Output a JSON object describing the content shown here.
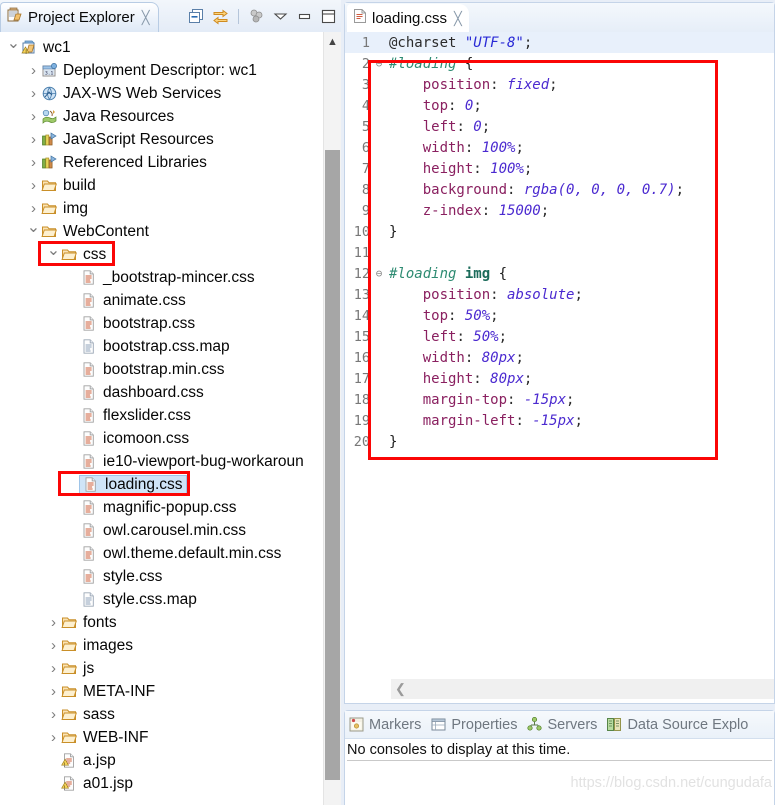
{
  "explorer": {
    "tab_label": "Project Explorer",
    "tab_close": "╳",
    "toolbar": [
      {
        "name": "collapse-all-icon",
        "title": "Collapse All"
      },
      {
        "name": "link-with-editor-icon",
        "title": "Link with Editor"
      },
      {
        "name": "filters-icon",
        "title": "Filters"
      },
      {
        "name": "view-menu-icon",
        "title": "View Menu"
      },
      {
        "name": "minimize-icon",
        "title": "Minimize"
      },
      {
        "name": "maximize-icon",
        "title": "Maximize"
      }
    ],
    "tree": [
      {
        "label": "wc1",
        "depth": 0,
        "arrow": "v",
        "icon": "project-warning-icon"
      },
      {
        "label": "Deployment Descriptor: wc1",
        "depth": 1,
        "arrow": ">",
        "icon": "deployment-descriptor-icon"
      },
      {
        "label": "JAX-WS Web Services",
        "depth": 1,
        "arrow": ">",
        "icon": "jaxws-icon"
      },
      {
        "label": "Java Resources",
        "depth": 1,
        "arrow": ">",
        "icon": "java-resources-icon"
      },
      {
        "label": "JavaScript Resources",
        "depth": 1,
        "arrow": ">",
        "icon": "js-resources-icon"
      },
      {
        "label": "Referenced Libraries",
        "depth": 1,
        "arrow": ">",
        "icon": "library-icon"
      },
      {
        "label": "build",
        "depth": 1,
        "arrow": ">",
        "icon": "folder-icon"
      },
      {
        "label": "img",
        "depth": 1,
        "arrow": ">",
        "icon": "folder-icon"
      },
      {
        "label": "WebContent",
        "depth": 1,
        "arrow": "v",
        "icon": "folder-open-icon"
      },
      {
        "label": "css",
        "depth": 2,
        "arrow": "v",
        "icon": "folder-icon",
        "highlight": "red-box"
      },
      {
        "label": "_bootstrap-mincer.css",
        "depth": 3,
        "arrow": "",
        "icon": "css-file-icon"
      },
      {
        "label": "animate.css",
        "depth": 3,
        "arrow": "",
        "icon": "css-file-icon"
      },
      {
        "label": "bootstrap.css",
        "depth": 3,
        "arrow": "",
        "icon": "css-file-icon"
      },
      {
        "label": "bootstrap.css.map",
        "depth": 3,
        "arrow": "",
        "icon": "plain-file-icon"
      },
      {
        "label": "bootstrap.min.css",
        "depth": 3,
        "arrow": "",
        "icon": "css-file-icon"
      },
      {
        "label": "dashboard.css",
        "depth": 3,
        "arrow": "",
        "icon": "css-file-icon"
      },
      {
        "label": "flexslider.css",
        "depth": 3,
        "arrow": "",
        "icon": "css-file-icon"
      },
      {
        "label": "icomoon.css",
        "depth": 3,
        "arrow": "",
        "icon": "css-file-icon"
      },
      {
        "label": "ie10-viewport-bug-workaroun",
        "depth": 3,
        "arrow": "",
        "icon": "css-file-icon"
      },
      {
        "label": "loading.css",
        "depth": 3,
        "arrow": "",
        "icon": "css-file-icon",
        "selected": true,
        "highlight": "red-box"
      },
      {
        "label": "magnific-popup.css",
        "depth": 3,
        "arrow": "",
        "icon": "css-file-icon"
      },
      {
        "label": "owl.carousel.min.css",
        "depth": 3,
        "arrow": "",
        "icon": "css-file-icon"
      },
      {
        "label": "owl.theme.default.min.css",
        "depth": 3,
        "arrow": "",
        "icon": "css-file-icon"
      },
      {
        "label": "style.css",
        "depth": 3,
        "arrow": "",
        "icon": "css-file-icon"
      },
      {
        "label": "style.css.map",
        "depth": 3,
        "arrow": "",
        "icon": "plain-file-icon"
      },
      {
        "label": "fonts",
        "depth": 2,
        "arrow": ">",
        "icon": "folder-icon"
      },
      {
        "label": "images",
        "depth": 2,
        "arrow": ">",
        "icon": "folder-icon"
      },
      {
        "label": "js",
        "depth": 2,
        "arrow": ">",
        "icon": "folder-icon"
      },
      {
        "label": "META-INF",
        "depth": 2,
        "arrow": ">",
        "icon": "folder-icon"
      },
      {
        "label": "sass",
        "depth": 2,
        "arrow": ">",
        "icon": "folder-icon"
      },
      {
        "label": "WEB-INF",
        "depth": 2,
        "arrow": ">",
        "icon": "folder-icon"
      },
      {
        "label": "a.jsp",
        "depth": 2,
        "arrow": "",
        "icon": "jsp-file-icon"
      },
      {
        "label": "a01.jsp",
        "depth": 2,
        "arrow": "",
        "icon": "jsp-file-icon"
      }
    ]
  },
  "editor": {
    "tab_label": "loading.css",
    "tab_close": "╳",
    "tab_icon": "css-file-icon",
    "code": [
      {
        "n": "1",
        "fold": "",
        "current": true,
        "tokens": [
          {
            "t": "@charset ",
            "c": "tok-at"
          },
          {
            "t": "\"UTF-8\"",
            "c": "tok-str"
          },
          {
            "t": ";",
            "c": "tok-punc"
          }
        ]
      },
      {
        "n": "2",
        "fold": "⊖",
        "tokens": [
          {
            "t": "#loading",
            "c": "tok-sel"
          },
          {
            "t": " {",
            "c": "tok-brace"
          }
        ]
      },
      {
        "n": "3",
        "fold": "",
        "tokens": [
          {
            "t": "    position",
            "c": "tok-prop"
          },
          {
            "t": ": ",
            "c": "tok-punc"
          },
          {
            "t": "fixed",
            "c": "tok-val"
          },
          {
            "t": ";",
            "c": "tok-punc"
          }
        ]
      },
      {
        "n": "4",
        "fold": "",
        "tokens": [
          {
            "t": "    top",
            "c": "tok-prop"
          },
          {
            "t": ": ",
            "c": "tok-punc"
          },
          {
            "t": "0",
            "c": "tok-val"
          },
          {
            "t": ";",
            "c": "tok-punc"
          }
        ]
      },
      {
        "n": "5",
        "fold": "",
        "tokens": [
          {
            "t": "    left",
            "c": "tok-prop"
          },
          {
            "t": ": ",
            "c": "tok-punc"
          },
          {
            "t": "0",
            "c": "tok-val"
          },
          {
            "t": ";",
            "c": "tok-punc"
          }
        ]
      },
      {
        "n": "6",
        "fold": "",
        "tokens": [
          {
            "t": "    width",
            "c": "tok-prop"
          },
          {
            "t": ": ",
            "c": "tok-punc"
          },
          {
            "t": "100%",
            "c": "tok-val"
          },
          {
            "t": ";",
            "c": "tok-punc"
          }
        ]
      },
      {
        "n": "7",
        "fold": "",
        "tokens": [
          {
            "t": "    height",
            "c": "tok-prop"
          },
          {
            "t": ": ",
            "c": "tok-punc"
          },
          {
            "t": "100%",
            "c": "tok-val"
          },
          {
            "t": ";",
            "c": "tok-punc"
          }
        ]
      },
      {
        "n": "8",
        "fold": "",
        "tokens": [
          {
            "t": "    background",
            "c": "tok-prop"
          },
          {
            "t": ": ",
            "c": "tok-punc"
          },
          {
            "t": "rgba(0, 0, 0, 0.7)",
            "c": "tok-val"
          },
          {
            "t": ";",
            "c": "tok-punc"
          }
        ]
      },
      {
        "n": "9",
        "fold": "",
        "tokens": [
          {
            "t": "    z-index",
            "c": "tok-prop"
          },
          {
            "t": ": ",
            "c": "tok-punc"
          },
          {
            "t": "15000",
            "c": "tok-val"
          },
          {
            "t": ";",
            "c": "tok-punc"
          }
        ]
      },
      {
        "n": "10",
        "fold": "",
        "tokens": [
          {
            "t": "}",
            "c": "tok-brace"
          }
        ]
      },
      {
        "n": "11",
        "fold": "",
        "tokens": []
      },
      {
        "n": "12",
        "fold": "⊖",
        "tokens": [
          {
            "t": "#loading",
            "c": "tok-sel"
          },
          {
            "t": " ",
            "c": "tok-punc"
          },
          {
            "t": "img",
            "c": "tok-el"
          },
          {
            "t": " {",
            "c": "tok-brace"
          }
        ]
      },
      {
        "n": "13",
        "fold": "",
        "tokens": [
          {
            "t": "    position",
            "c": "tok-prop"
          },
          {
            "t": ": ",
            "c": "tok-punc"
          },
          {
            "t": "absolute",
            "c": "tok-val"
          },
          {
            "t": ";",
            "c": "tok-punc"
          }
        ]
      },
      {
        "n": "14",
        "fold": "",
        "tokens": [
          {
            "t": "    top",
            "c": "tok-prop"
          },
          {
            "t": ": ",
            "c": "tok-punc"
          },
          {
            "t": "50%",
            "c": "tok-val"
          },
          {
            "t": ";",
            "c": "tok-punc"
          }
        ]
      },
      {
        "n": "15",
        "fold": "",
        "tokens": [
          {
            "t": "    left",
            "c": "tok-prop"
          },
          {
            "t": ": ",
            "c": "tok-punc"
          },
          {
            "t": "50%",
            "c": "tok-val"
          },
          {
            "t": ";",
            "c": "tok-punc"
          }
        ]
      },
      {
        "n": "16",
        "fold": "",
        "tokens": [
          {
            "t": "    width",
            "c": "tok-prop"
          },
          {
            "t": ": ",
            "c": "tok-punc"
          },
          {
            "t": "80px",
            "c": "tok-val"
          },
          {
            "t": ";",
            "c": "tok-punc"
          }
        ]
      },
      {
        "n": "17",
        "fold": "",
        "tokens": [
          {
            "t": "    height",
            "c": "tok-prop"
          },
          {
            "t": ": ",
            "c": "tok-punc"
          },
          {
            "t": "80px",
            "c": "tok-val"
          },
          {
            "t": ";",
            "c": "tok-punc"
          }
        ]
      },
      {
        "n": "18",
        "fold": "",
        "tokens": [
          {
            "t": "    margin-top",
            "c": "tok-prop"
          },
          {
            "t": ": ",
            "c": "tok-punc"
          },
          {
            "t": "-15px",
            "c": "tok-val"
          },
          {
            "t": ";",
            "c": "tok-punc"
          }
        ]
      },
      {
        "n": "19",
        "fold": "",
        "tokens": [
          {
            "t": "    margin-left",
            "c": "tok-prop"
          },
          {
            "t": ": ",
            "c": "tok-punc"
          },
          {
            "t": "-15px",
            "c": "tok-val"
          },
          {
            "t": ";",
            "c": "tok-punc"
          }
        ]
      },
      {
        "n": "20",
        "fold": "",
        "tokens": [
          {
            "t": "}",
            "c": "tok-brace"
          }
        ]
      }
    ]
  },
  "console": {
    "tabs": [
      {
        "label": "Markers",
        "icon": "markers-icon"
      },
      {
        "label": "Properties",
        "icon": "properties-icon"
      },
      {
        "label": "Servers",
        "icon": "servers-icon"
      },
      {
        "label": "Data Source Explo",
        "icon": "data-source-icon"
      }
    ],
    "message": "No consoles to display at this time.",
    "watermark": "https://blog.csdn.net/cungudafa"
  },
  "colors": {
    "annotation_red": "#fb0606",
    "selection_blue": "#cfe4f7",
    "current_line": "#e8f0fb"
  }
}
